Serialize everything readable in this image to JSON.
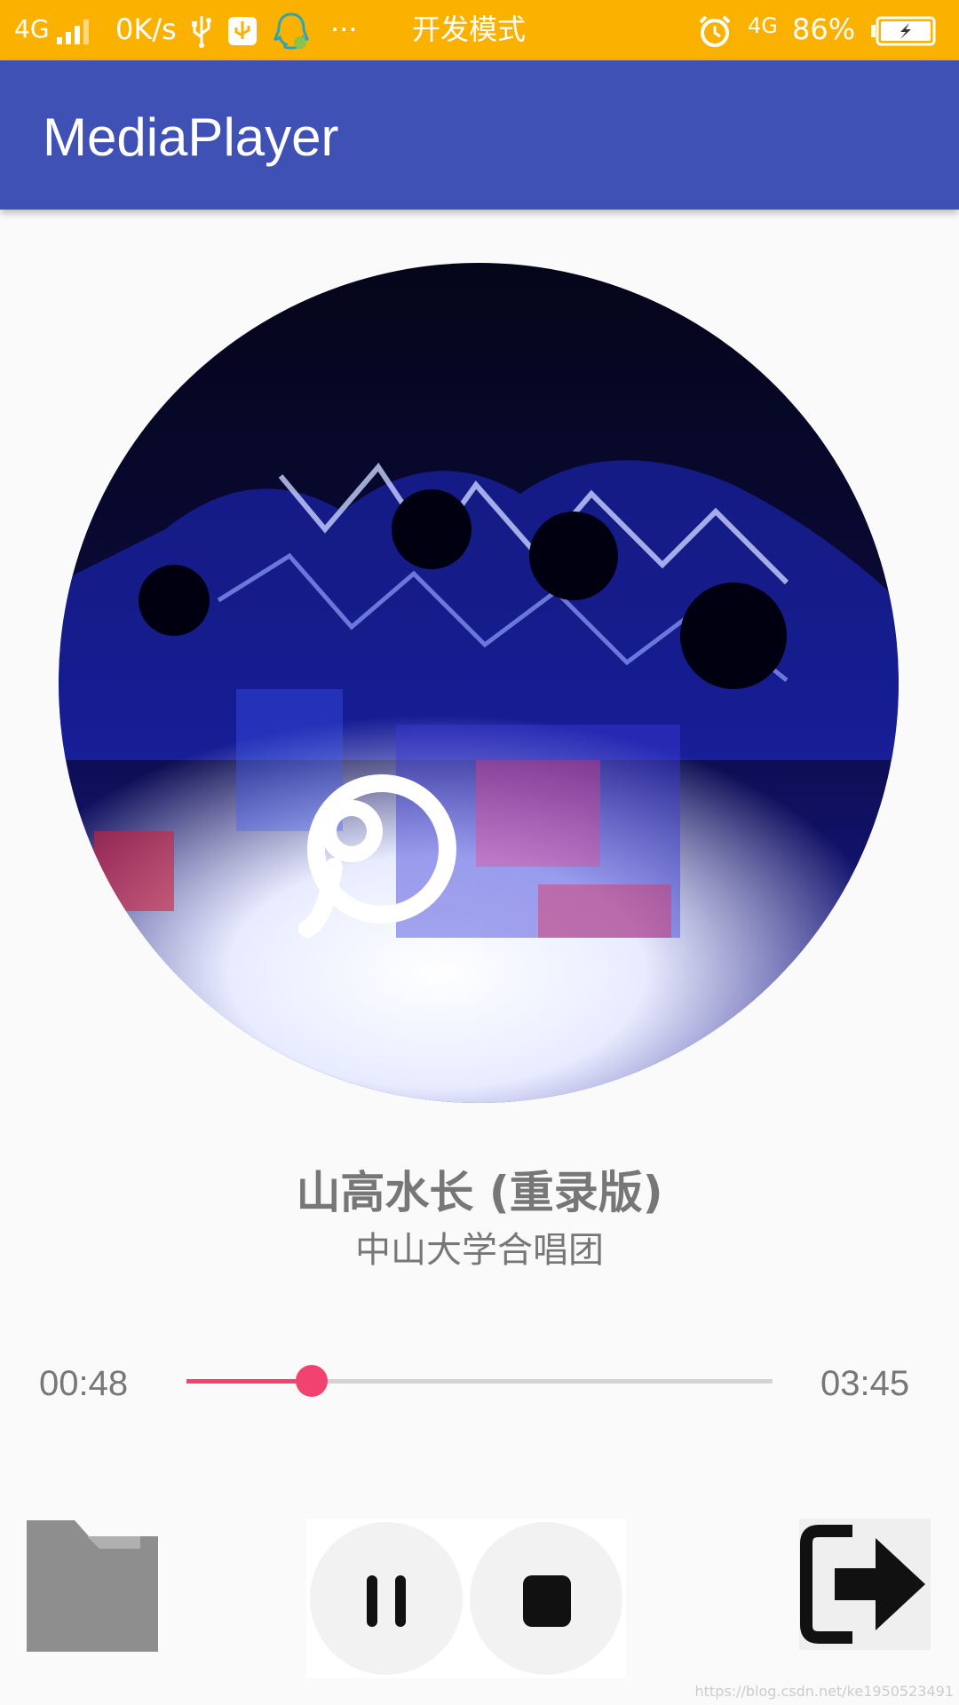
{
  "status_bar": {
    "network": "4G",
    "speed": "0K/s",
    "more": "···",
    "mode": "开发模式",
    "network_right": "4G",
    "battery": "86%",
    "icons": [
      "signal-icon",
      "usb-icon",
      "usb-debug-icon",
      "qq-icon",
      "alarm-icon",
      "battery-charging-icon"
    ]
  },
  "app_bar": {
    "title": "MediaPlayer"
  },
  "album": {
    "icon": "music-note-logo-icon"
  },
  "song": {
    "title": "山高水长 (重录版)",
    "artist": "中山大学合唱团"
  },
  "progress": {
    "elapsed": "00:48",
    "total": "03:45",
    "fraction": 0.213
  },
  "controls": {
    "folder": "folder-icon",
    "pause": "pause-icon",
    "stop": "stop-icon",
    "exit": "exit-icon"
  },
  "colors": {
    "status_bar": "#fbb100",
    "app_bar": "#3f51b5",
    "accent": "#f0436f",
    "text_secondary": "#777777"
  },
  "watermark": "https://blog.csdn.net/ke1950523491"
}
